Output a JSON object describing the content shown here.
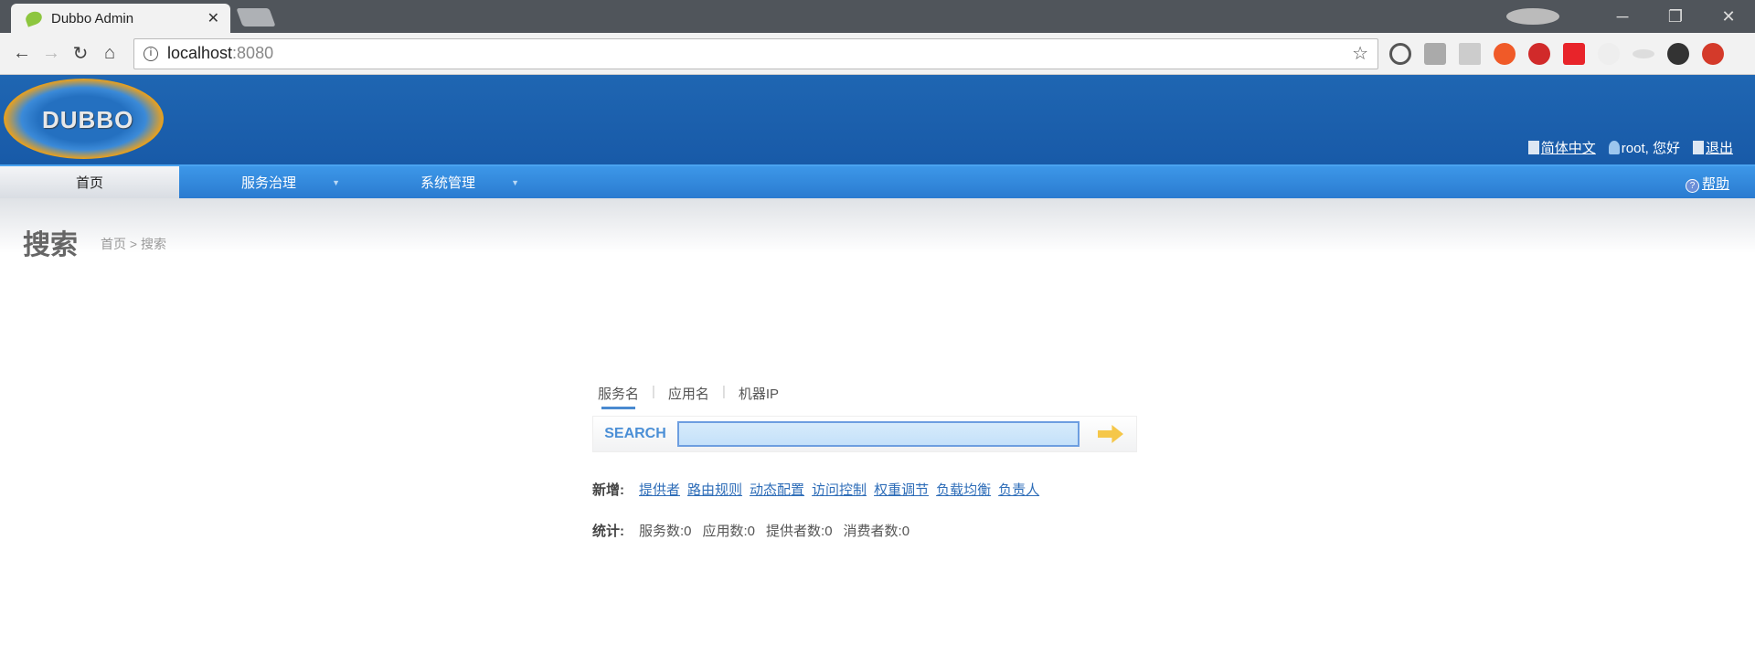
{
  "browser": {
    "tab_title": "Dubbo Admin",
    "url_host": "localhost",
    "url_port": ":8080"
  },
  "header": {
    "logo_text": "DUBBO",
    "lang": "简体中文",
    "user": "root, 您好",
    "logout": "退出"
  },
  "nav": {
    "items": [
      {
        "label": "首页"
      },
      {
        "label": "服务治理"
      },
      {
        "label": "系统管理"
      }
    ],
    "help": "帮助"
  },
  "page": {
    "title": "搜索",
    "breadcrumb": "首页 > 搜索"
  },
  "search": {
    "tabs": [
      "服务名",
      "应用名",
      "机器IP"
    ],
    "label": "SEARCH",
    "value": ""
  },
  "add": {
    "label": "新增:",
    "links": [
      "提供者",
      "路由规则",
      "动态配置",
      "访问控制",
      "权重调节",
      "负载均衡",
      "负责人"
    ]
  },
  "stats": {
    "label": "统计:",
    "items": [
      "服务数:0",
      "应用数:0",
      "提供者数:0",
      "消费者数:0"
    ]
  }
}
